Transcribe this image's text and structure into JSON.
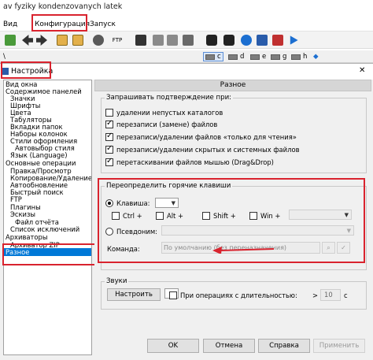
{
  "app": {
    "title": "av fyziky kondenzovanych latek"
  },
  "menubar": {
    "items": [
      "Вид",
      "Конфигурация",
      "Запуск"
    ]
  },
  "toolbar": {
    "icons": [
      "refresh-icon",
      "back-icon",
      "forward-icon",
      "pack-icon",
      "unpack-icon",
      "search-icon",
      "ftp-icon",
      "ftp-disconnect-icon",
      "copy-icon",
      "move-icon",
      "find-icon",
      "sync-icon",
      "media-icon",
      "play-icon"
    ],
    "ftp_label": "FTP"
  },
  "drivebar": {
    "left_label": "\\",
    "drives": [
      "c",
      "d",
      "e",
      "g",
      "h"
    ]
  },
  "dialog": {
    "title": "Настройка",
    "close_label": "✕",
    "tree": [
      "Вид окна",
      "Содержимое панелей",
      "Значки",
      "Шрифты",
      "Цвета",
      "Табуляторы",
      "Вкладки папок",
      "Наборы колонок",
      "Стили оформления",
      "Автовыбор стиля",
      "Язык (Language)",
      "Основные операции",
      "Правка/Просмотр",
      "Копирование/Удаление",
      "Автообновление",
      "Быстрый поиск",
      "FTP",
      "Плагины",
      "Эскизы",
      "Файл отчёта",
      "Список исключений",
      "Архиваторы",
      "Архиватор ZIP",
      "Разное"
    ],
    "selected_index": 23,
    "panel_title": "Разное",
    "confirm": {
      "label": "Запрашивать подтверждение при:",
      "options": [
        {
          "label": "удалении непустых каталогов",
          "checked": false
        },
        {
          "label": "перезаписи (замене) файлов",
          "checked": true
        },
        {
          "label": "перезаписи/удалении файлов «только для чтения»",
          "checked": true
        },
        {
          "label": "перезаписи/удалении скрытых и системных файлов",
          "checked": true
        },
        {
          "label": "перетаскивании файлов мышью (Drag&Drop)",
          "checked": true
        }
      ]
    },
    "hotkeys": {
      "label": "Переопределить горячие клавиши",
      "key_radio": "Клавиша:",
      "modifiers": [
        "Ctrl +",
        "Alt +",
        "Shift +",
        "Win +"
      ],
      "alias_radio": "Псевдоним:",
      "command_label": "Команда:",
      "command_placeholder": "По умолчанию (без переназначения)"
    },
    "sounds": {
      "label": "Звуки",
      "setup_button": "Настроить",
      "duration_label": "При операциях с длительностью:",
      "gt": ">",
      "seconds_value": "10",
      "seconds_unit": "с"
    },
    "buttons": {
      "ok": "OK",
      "cancel": "Отмена",
      "help": "Справка",
      "apply": "Применить"
    }
  },
  "colors": {
    "highlight": "#d9232e",
    "selection": "#0078d7"
  }
}
